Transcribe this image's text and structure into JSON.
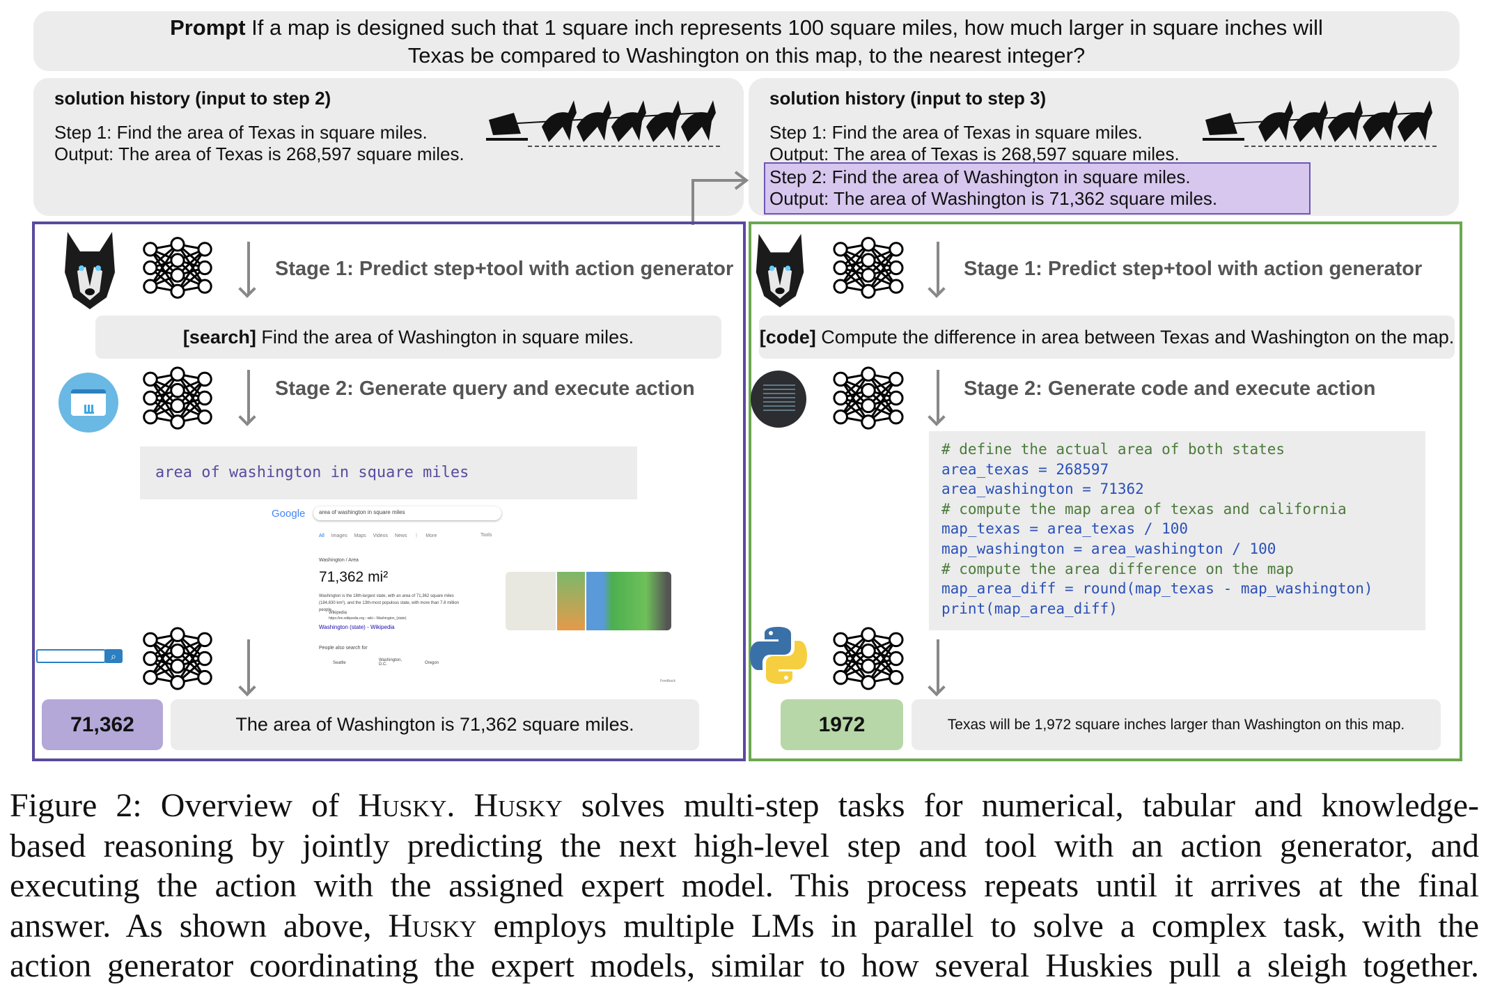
{
  "prompt": {
    "label": "Prompt",
    "text_line1": " If a map is designed such that 1 square inch represents 100 square miles, how much larger in square inches will",
    "text_line2": "Texas be compared to Washington on this map, to the nearest integer?"
  },
  "left_history": {
    "title": "solution history (input to step 2)",
    "lines": [
      "Step 1: Find the area of Texas in square miles.",
      "Output: The area of Texas is 268,597 square miles."
    ]
  },
  "right_history": {
    "title": "solution history (input to step 3)",
    "lines": [
      "Step 1: Find the area of Texas in square miles.",
      "Output: The area of Texas is 268,597 square miles."
    ],
    "highlight": [
      "Step 2: Find the area of Washington in square miles.",
      "Output: The area of Washington is 71,362 square miles."
    ]
  },
  "left_panel": {
    "stage1": "Stage 1: Predict step+tool with action generator",
    "step_tag": "[search]",
    "step_text": " Find the area of Washington in square miles.",
    "stage2": "Stage 2: Generate query and execute action",
    "query": "area of washington in square miles",
    "google": {
      "logo": "Google",
      "search": "area of washington in square miles",
      "tabs": [
        "All",
        "Images",
        "Maps",
        "Videos",
        "News",
        "⋮ More"
      ],
      "tools": "Tools",
      "breadcrumb": "Washington / Area",
      "answer": "71,362 mi²",
      "snippet": "Washington is the 18th-largest state, with an area of 71,362 square miles (184,830 km²), and the 13th-most populous state, with more than 7.8 million people.",
      "source": "Wikipedia",
      "url": "https://en.wikipedia.org › wiki › Washington_(state)",
      "link": "Washington (state) - Wikipedia",
      "people_also": "People also search for",
      "related": [
        "Seattle",
        "Washington, D.C.",
        "Oregon"
      ],
      "feedback": "Feedback"
    },
    "answer": "71,362",
    "output": "The area of Washington is 71,362 square miles."
  },
  "right_panel": {
    "stage1": "Stage 1: Predict step+tool with action generator",
    "step_tag": "[code]",
    "step_text": " Compute the difference in area between Texas and Washington on the map.",
    "stage2": "Stage 2: Generate code and execute action",
    "code": [
      {
        "t": "# define the actual area of both states",
        "c": "cm"
      },
      {
        "t": "area_texas = 268597",
        "c": "cd"
      },
      {
        "t": "area_washington = 71362",
        "c": "cd"
      },
      {
        "t": "# compute the map area of texas and california",
        "c": "cm"
      },
      {
        "t": "map_texas = area_texas / 100",
        "c": "cd"
      },
      {
        "t": "map_washington = area_washington / 100",
        "c": "cd"
      },
      {
        "t": "# compute the area difference on the map",
        "c": "cm"
      },
      {
        "t": "map_area_diff = round(map_texas - map_washington)",
        "c": "cd"
      },
      {
        "t": "print(map_area_diff)",
        "c": "cd"
      }
    ],
    "answer": "1972",
    "output": "Texas will be 1,972 square inches larger than Washington on this map."
  },
  "colors": {
    "left_panel_border": "#5a4a9e",
    "right_panel_border": "#6aa84f",
    "left_answer": "#b4a8d8",
    "right_answer": "#b7d7a8",
    "highlight": "#d7c7ee"
  },
  "icons": [
    "husky-icon",
    "neural-network-icon",
    "browser-icon",
    "search-bar-icon",
    "code-icon",
    "python-icon",
    "sled-dogs-icon"
  ],
  "caption": [
    [
      {
        "t": "Figure 2: Overview of "
      },
      {
        "t": "Husky",
        "sc": true
      },
      {
        "t": ". "
      },
      {
        "t": "Husky",
        "sc": true
      },
      {
        "t": " solves multi-step tasks for numerical, tabular and knowledge-"
      }
    ],
    [
      {
        "t": "based reasoning by jointly predicting the next high-level step and tool with an action generator, and"
      }
    ],
    [
      {
        "t": "executing the action with the assigned expert model. This process repeats until it arrives at the final"
      }
    ],
    [
      {
        "t": "answer. As shown above, "
      },
      {
        "t": "Husky",
        "sc": true
      },
      {
        "t": " employs multiple LMs in parallel to solve a complex task, with the"
      }
    ],
    [
      {
        "t": "action generator coordinating the expert models, similar to how several Huskies pull a sleigh together."
      }
    ]
  ]
}
